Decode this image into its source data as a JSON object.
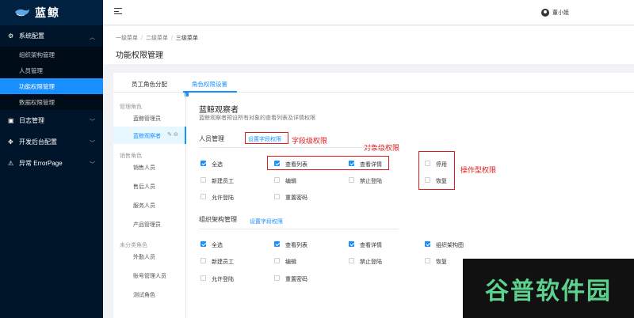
{
  "app": {
    "name": "蓝鲸"
  },
  "sidebar": {
    "groups": [
      {
        "label": "系统配置",
        "icon": "gear-icon",
        "expanded": true
      },
      {
        "label": "日志管理",
        "icon": "calendar-icon",
        "expanded": false
      },
      {
        "label": "开发后台配置",
        "icon": "puzzle-icon",
        "expanded": false
      },
      {
        "label": "异常 ErrorPage",
        "icon": "warning-icon",
        "expanded": false
      }
    ],
    "items": [
      {
        "label": "组织架构管理"
      },
      {
        "label": "人员管理"
      },
      {
        "label": "功能权限管理",
        "active": true
      },
      {
        "label": "数据权限管理"
      }
    ]
  },
  "header": {
    "user": "董小姐"
  },
  "breadcrumb": {
    "items": [
      "一级菜单",
      "二级菜单",
      "三级菜单"
    ]
  },
  "page": {
    "title": "功能权限管理"
  },
  "tabs": [
    {
      "label": "员工角色分配",
      "active": false
    },
    {
      "label": "角色权限设置",
      "active": true
    }
  ],
  "roles": {
    "groups": [
      {
        "label": "管理角色",
        "items": [
          "蓝鲸管理员",
          "蓝鲸观察者"
        ]
      },
      {
        "label": "销售角色",
        "items": [
          "销售人员",
          "售后人员",
          "服务人员",
          "产品管理员"
        ]
      },
      {
        "label": "未分类角色",
        "items": [
          "外勤人员",
          "账号管理人员",
          "测试角色"
        ]
      }
    ],
    "selected": "蓝鲸观察者",
    "tools": {
      "edit": "✎",
      "remove": "⊖"
    }
  },
  "permissions": {
    "title": "蓝鲸观察者",
    "desc": "蓝鲸观察者预设所有对象的查看列表及详情权限",
    "sections": [
      {
        "label": "人员管理",
        "link": "设置字段权限",
        "checks": [
          {
            "label": "全选",
            "checked": true
          },
          {
            "label": "查看列表",
            "checked": true
          },
          {
            "label": "查看详情",
            "checked": true
          },
          {
            "label": "停用",
            "checked": false
          },
          {
            "label": "新建员工",
            "checked": false
          },
          {
            "label": "编辑",
            "checked": false
          },
          {
            "label": "禁止登陆",
            "checked": false
          },
          {
            "label": "恢复",
            "checked": false
          },
          {
            "label": "允许登陆",
            "checked": false
          },
          {
            "label": "重置密码",
            "checked": false
          }
        ]
      },
      {
        "label": "组织架构管理",
        "link": "设置字段权限",
        "checks": [
          {
            "label": "全选",
            "checked": true
          },
          {
            "label": "查看列表",
            "checked": true
          },
          {
            "label": "查看详情",
            "checked": true
          },
          {
            "label": "组织架构图",
            "checked": true
          },
          {
            "label": "新建员工",
            "checked": false
          },
          {
            "label": "编辑",
            "checked": false
          },
          {
            "label": "禁止登陆",
            "checked": false
          },
          {
            "label": "恢复",
            "checked": false
          },
          {
            "label": "允许登陆",
            "checked": false
          },
          {
            "label": "重置密码",
            "checked": false
          }
        ]
      }
    ]
  },
  "annotations": {
    "field": "字段级权限",
    "object": "对象级权限",
    "operation": "操作型权限",
    "color": "#e02020"
  },
  "watermark": "谷普软件园",
  "colors": {
    "accent": "#1890ff",
    "sidebar": "#001529"
  }
}
